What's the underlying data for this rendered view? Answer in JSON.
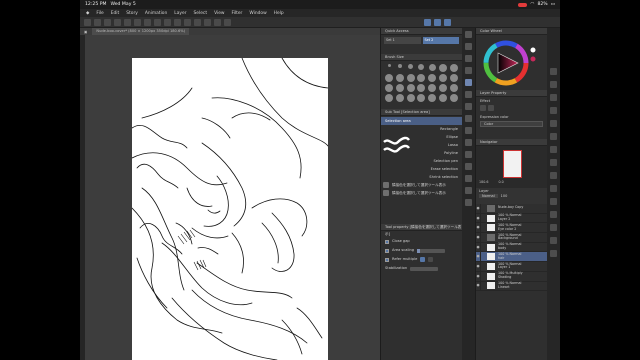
{
  "status": {
    "time": "12:25 PM",
    "date": "Wed May 5",
    "battery": "82%"
  },
  "menu": [
    "File",
    "Edit",
    "Story",
    "Animation",
    "Layer",
    "Select",
    "View",
    "Filter",
    "Window",
    "Help"
  ],
  "canvas_tab": "Nude-boo-cover* (800 × 1200px 350dpi 180.6%)",
  "quick_access": {
    "title": "Quick Access",
    "set1": "Set 1",
    "set2": "Set 2"
  },
  "brush_size": {
    "title": "Brush Size"
  },
  "subtool": {
    "title": "Sub Tool [Selection area]",
    "items": [
      "Selection area",
      "Rectangle",
      "Ellipse",
      "Lasso",
      "Polyline",
      "Selection pen",
      "Erase selection",
      "Shrink selection"
    ],
    "jp_items": [
      "隣接色を選択して選択ツール表示",
      "隣接色を選択して選択ツール表示"
    ]
  },
  "tool_property": {
    "title": "Tool property [隣接色を選択して選択ツール表示]"
  },
  "props": [
    {
      "label": "Close gap",
      "value": ""
    },
    {
      "label": "Area scaling",
      "value": "0"
    },
    {
      "label": "Refer multiple",
      "value": ""
    },
    {
      "label": "Stabilization",
      "value": "0"
    }
  ],
  "color_wheel": {
    "title": "Color Wheel"
  },
  "layer_property": {
    "title": "Layer Property",
    "effect": "Effect",
    "expression": "Expression color",
    "color_mode": "Color"
  },
  "navigator": {
    "title": "Navigator",
    "zoom": "180.6",
    "angle": "0.0"
  },
  "layer_panel": {
    "title": "Layer",
    "blend": "Normal",
    "opacity": "100"
  },
  "layers": [
    {
      "name": "Nude-boy Copy",
      "mode": "",
      "type": "group"
    },
    {
      "name": "100 % Normal",
      "mode": "Layer 2",
      "type": "raster"
    },
    {
      "name": "100 % Normal",
      "mode": "Eye color 2",
      "type": "raster"
    },
    {
      "name": "100 % Normal",
      "mode": "Background",
      "type": "group"
    },
    {
      "name": "100 % Normal",
      "mode": "body",
      "type": "raster"
    },
    {
      "name": "100 % Normal",
      "mode": "hair",
      "type": "raster",
      "selected": true
    },
    {
      "name": "100 % Normal",
      "mode": "Layer 1",
      "type": "raster"
    },
    {
      "name": "100 % Multiply",
      "mode": "Shading",
      "type": "raster"
    },
    {
      "name": "100 % Normal",
      "mode": "Lineart",
      "type": "raster"
    }
  ],
  "colors": {
    "accent": "#5677a8",
    "selected_row": "#4a5f86",
    "record": "#e23b3b"
  }
}
